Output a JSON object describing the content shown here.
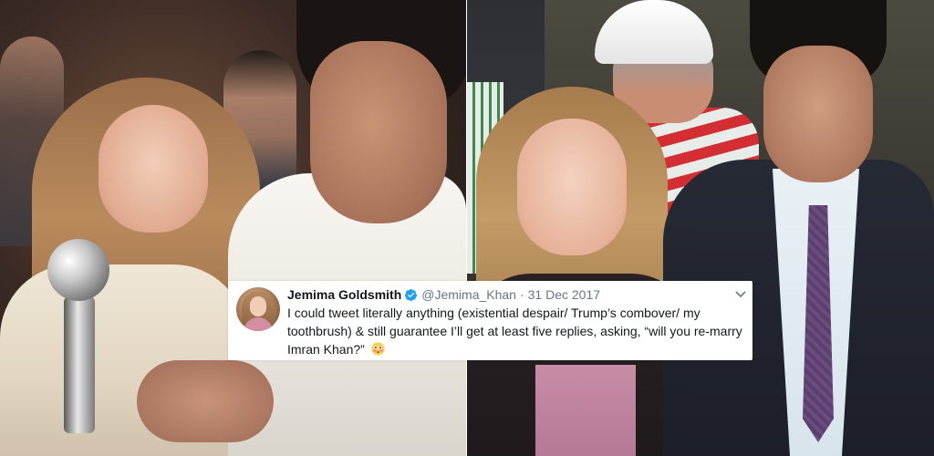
{
  "tweet": {
    "display_name": "Jemima Goldsmith",
    "handle": "@Jemima_Khan",
    "separator": "·",
    "date": "31 Dec 2017",
    "text": "I could tweet literally anything (existential despair/ Trump’s combover/ my toothbrush) & still guarantee I’ll get at least five replies, asking, “will you re-marry Imran Khan?”",
    "icons": {
      "verified": "verified-badge-icon",
      "menu": "chevron-down-icon",
      "emoji": "flushed-face-emoji"
    }
  },
  "colors": {
    "verified_blue": "#1da1f2",
    "name_text": "#14171a",
    "meta_text": "#657786",
    "card_background": "#ffffff"
  }
}
